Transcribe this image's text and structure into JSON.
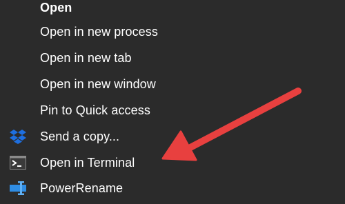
{
  "menu": {
    "items": [
      {
        "label": "Open",
        "icon": ""
      },
      {
        "label": "Open in new process",
        "icon": ""
      },
      {
        "label": "Open in new tab",
        "icon": ""
      },
      {
        "label": "Open in new window",
        "icon": ""
      },
      {
        "label": "Pin to Quick access",
        "icon": ""
      },
      {
        "label": "Send a copy...",
        "icon": "dropbox-icon"
      },
      {
        "label": "Open in Terminal",
        "icon": "terminal-icon"
      },
      {
        "label": "PowerRename",
        "icon": "powerrename-icon"
      }
    ]
  },
  "annotation": {
    "arrow_color": "#e8403f"
  },
  "colors": {
    "background": "#2b2b2b",
    "text": "#ffffff",
    "dropbox": "#1e6fe0",
    "powerrename": "#2f8de4"
  }
}
